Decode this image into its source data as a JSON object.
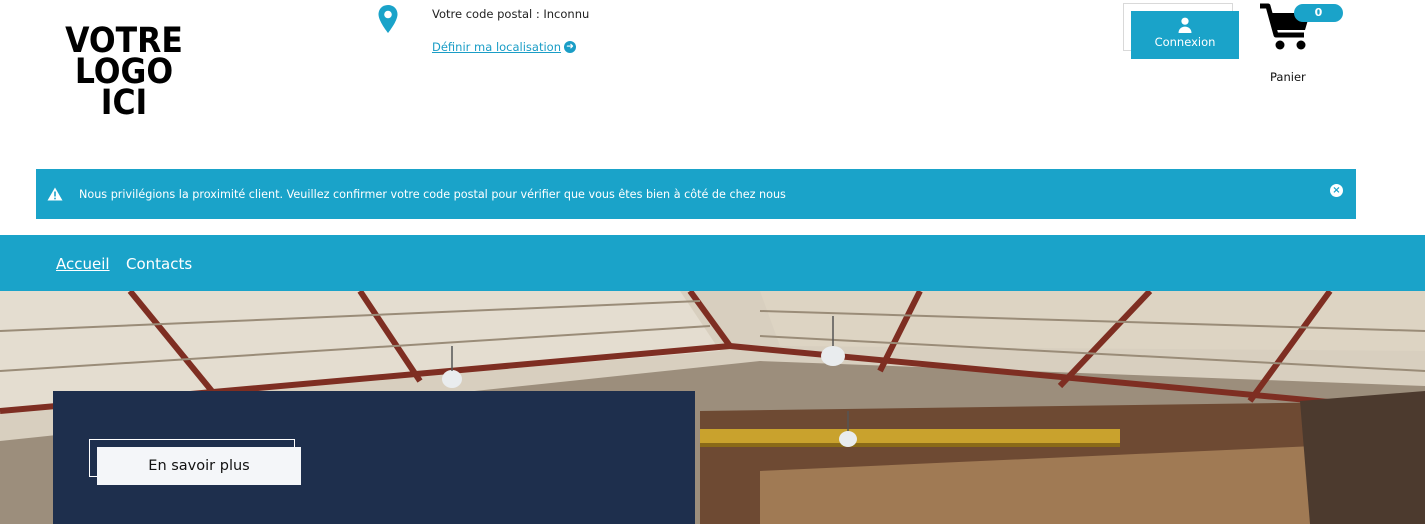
{
  "logo": {
    "lines": [
      "VOTRE",
      "LOGO",
      "ICI"
    ]
  },
  "location": {
    "postal_line": "Votre code postal : Inconnu",
    "set_location": "Définir ma localisation"
  },
  "account": {
    "login_label": "Connexion"
  },
  "cart": {
    "count": "0",
    "label": "Panier"
  },
  "alert": {
    "message": "Nous privilégions la proximité client. Veuillez confirmer votre code postal pour vérifier que vous êtes bien à côté de chez nous"
  },
  "nav": {
    "items": [
      {
        "label": "Accueil",
        "active": true
      },
      {
        "label": "Contacts",
        "active": false
      }
    ]
  },
  "hero": {
    "cta_label": "En savoir plus"
  },
  "colors": {
    "accent": "#1aa3c9",
    "panel": "#1e2f4d"
  }
}
